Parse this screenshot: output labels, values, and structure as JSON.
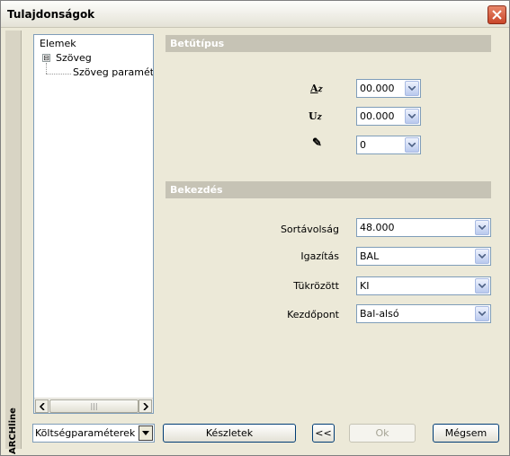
{
  "window": {
    "title": "Tulajdonságok"
  },
  "sidebar": {
    "label": "ARCHline"
  },
  "tree": {
    "items": [
      {
        "label": "Elemek"
      },
      {
        "label": "Szöveg",
        "expanded": true,
        "toggle": "⊟"
      },
      {
        "label": "Szöveg paraméterei"
      }
    ],
    "scroll_left": "‹",
    "scroll_right": "›",
    "scroll_thumb_grip": "|||"
  },
  "font_section": {
    "title": "Betűtípus",
    "rows": [
      {
        "icon": "font-height-icon",
        "icon_text": "A",
        "icon_sub": "z",
        "value": "00.000"
      },
      {
        "icon": "font-width-icon",
        "icon_text": "U",
        "icon_sub": "z",
        "value": "00.000"
      },
      {
        "icon": "pen-icon",
        "icon_text": "✎",
        "value": "0"
      }
    ]
  },
  "paragraph_section": {
    "title": "Bekezdés",
    "rows": [
      {
        "label": "Sortávolság",
        "value": "48.000"
      },
      {
        "label": "Igazítás",
        "value": "BAL"
      },
      {
        "label": "Tükrözött",
        "value": "KI"
      },
      {
        "label": "Kezdőpont",
        "value": "Bal-alsó"
      }
    ]
  },
  "footer": {
    "cost_params": "Költségparaméterek",
    "sets_button": "Készletek",
    "back_button": "<<",
    "ok_button": "Ok",
    "cancel_button": "Mégsem"
  },
  "colors": {
    "section_header_bg": "#c6c3b5",
    "window_bg": "#ece9d8",
    "close_button": "#d5553a",
    "combo_border": "#7f9db9"
  }
}
